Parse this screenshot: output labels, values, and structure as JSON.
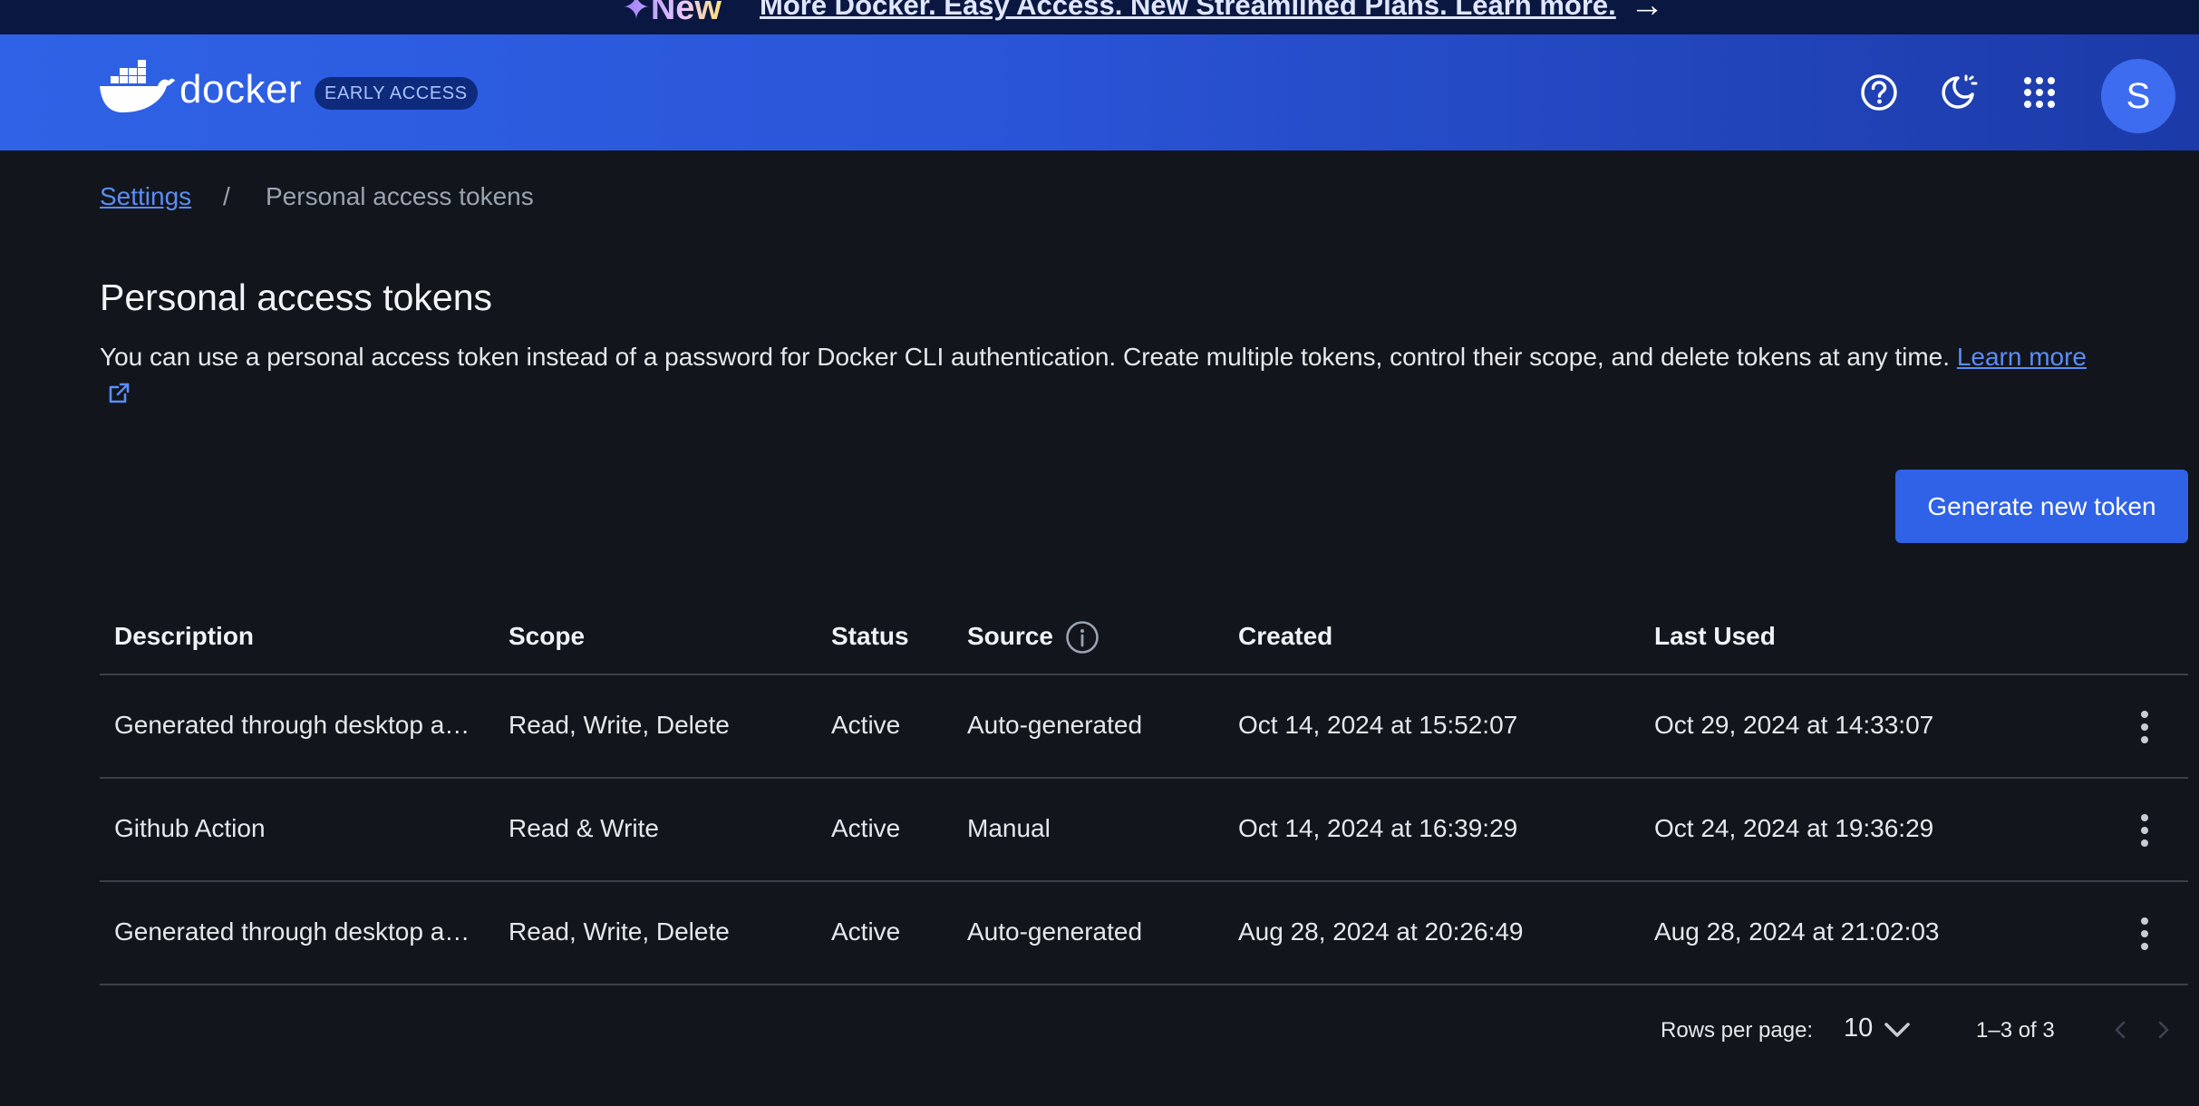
{
  "announcement": {
    "badge": "✦New",
    "link_text": "More Docker. Easy Access. New Streamlined Plans. Learn more.",
    "arrow": "→"
  },
  "header": {
    "logo_text": "docker",
    "badge": "EARLY ACCESS",
    "avatar_initial": "S",
    "icons": [
      "help-icon",
      "theme-toggle-icon",
      "apps-grid-icon"
    ]
  },
  "breadcrumb": {
    "parent": "Settings",
    "separator": "/",
    "current": "Personal access tokens"
  },
  "page": {
    "title": "Personal access tokens",
    "description": "You can use a personal access token instead of a password for Docker CLI authentication. Create multiple tokens, control their scope, and delete tokens at any time.",
    "learn_more": "Learn more",
    "primary_button": "Generate new token"
  },
  "table": {
    "columns": [
      "Description",
      "Scope",
      "Status",
      "Source",
      "Created",
      "Last Used"
    ],
    "rows": [
      {
        "description": "Generated through desktop a…",
        "scope": "Read, Write, Delete",
        "status": "Active",
        "source": "Auto-generated",
        "created": "Oct 14, 2024 at 15:52:07",
        "last_used": "Oct 29, 2024 at 14:33:07"
      },
      {
        "description": "Github Action",
        "scope": "Read & Write",
        "status": "Active",
        "source": "Manual",
        "created": "Oct 14, 2024 at 16:39:29",
        "last_used": "Oct 24, 2024 at 19:36:29"
      },
      {
        "description": "Generated through desktop a…",
        "scope": "Read, Write, Delete",
        "status": "Active",
        "source": "Auto-generated",
        "created": "Aug 28, 2024 at 20:26:49",
        "last_used": "Aug 28, 2024 at 21:02:03"
      }
    ]
  },
  "pagination": {
    "rows_per_page_label": "Rows per page:",
    "rows_per_page_value": "10",
    "range": "1–3 of 3"
  },
  "colors": {
    "background": "#12151b",
    "header_start": "#2f62e6",
    "header_end": "#1c3aa8",
    "accent": "#2f62e6",
    "link": "#5b8df6"
  }
}
